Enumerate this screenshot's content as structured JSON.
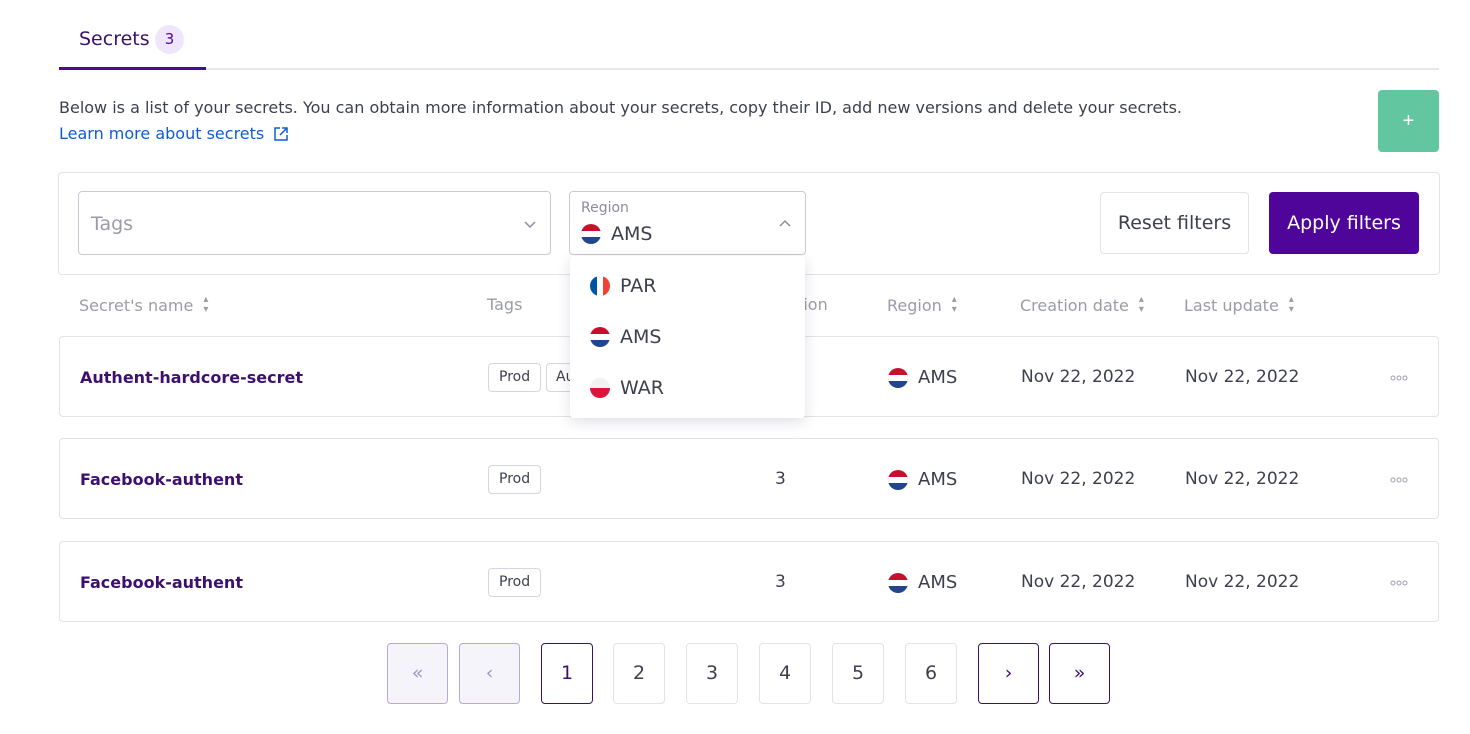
{
  "tabs": {
    "label": "Secrets",
    "count": "3"
  },
  "intro": {
    "text": "Below is a list of your secrets. You can obtain more information about your secrets, copy their ID, add new versions and delete your secrets.",
    "link": "Learn more about secrets"
  },
  "add_button": {
    "label": "+"
  },
  "filters": {
    "tags_placeholder": "Tags",
    "region_label": "Region",
    "region_value": "AMS",
    "reset_label": "Reset filters",
    "apply_label": "Apply filters"
  },
  "region_options": [
    "PAR",
    "AMS",
    "WAR"
  ],
  "table": {
    "headers": {
      "name": "Secret's name",
      "tags": "Tags",
      "version": "sion",
      "region": "Region",
      "created": "Creation date",
      "updated": "Last update"
    },
    "rows": [
      {
        "name": "Authent-hardcore-secret",
        "tags": [
          "Prod",
          "Au"
        ],
        "version": "",
        "region": "AMS",
        "created": "Nov 22, 2022",
        "updated": "Nov 22, 2022"
      },
      {
        "name": "Facebook-authent",
        "tags": [
          "Prod"
        ],
        "version": "3",
        "region": "AMS",
        "created": "Nov 22, 2022",
        "updated": "Nov 22, 2022"
      },
      {
        "name": "Facebook-authent",
        "tags": [
          "Prod"
        ],
        "version": "3",
        "region": "AMS",
        "created": "Nov 22, 2022",
        "updated": "Nov 22, 2022"
      }
    ]
  },
  "pagination": {
    "first": "«",
    "prev": "‹",
    "pages": [
      "1",
      "2",
      "3",
      "4",
      "5",
      "6"
    ],
    "current": "1",
    "next": "›",
    "last": "»"
  },
  "colors": {
    "primary": "#4f0599",
    "success": "#62c7a1",
    "link": "#0e5cd8",
    "flag_nl_red": "#c8102e",
    "flag_nl_blue": "#21468b",
    "flag_fr_blue": "#0055a4",
    "flag_fr_red": "#ef4135"
  }
}
